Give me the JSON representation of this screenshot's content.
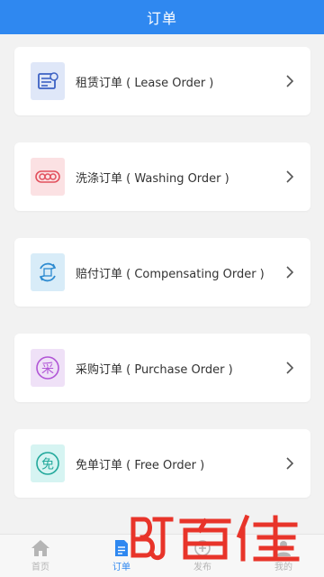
{
  "header": {
    "title": "订单"
  },
  "orders": [
    {
      "label": "租赁订单 ( Lease Order )",
      "icon": "lease-order-icon",
      "icon_bg": "#dfe7f8",
      "icon_color": "#3d62c4"
    },
    {
      "label": "洗涤订单 ( Washing Order )",
      "icon": "washing-order-icon",
      "icon_bg": "#fbe1e3",
      "icon_color": "#e2505d"
    },
    {
      "label": "赔付订单 ( Compensating Order )",
      "icon": "compensating-order-icon",
      "icon_bg": "#d8ecf8",
      "icon_color": "#2c8ad0"
    },
    {
      "label": "采购订单 ( Purchase Order )",
      "icon": "purchase-order-icon",
      "icon_bg": "#efe1f7",
      "icon_color": "#b155d6",
      "glyph": "采"
    },
    {
      "label": "免单订单 ( Free Order )",
      "icon": "free-order-icon",
      "icon_bg": "#d6f4f2",
      "icon_color": "#21a89b",
      "glyph": "免"
    }
  ],
  "tabbar": {
    "tabs": [
      {
        "label": "首页",
        "icon": "home-icon",
        "active": false
      },
      {
        "label": "订单",
        "icon": "order-doc-icon",
        "active": true
      },
      {
        "label": "发布",
        "icon": "publish-icon",
        "active": false
      },
      {
        "label": "我的",
        "icon": "profile-icon",
        "active": false
      }
    ]
  },
  "colors": {
    "primary": "#2f88f0",
    "watermark": "#e8342a"
  }
}
